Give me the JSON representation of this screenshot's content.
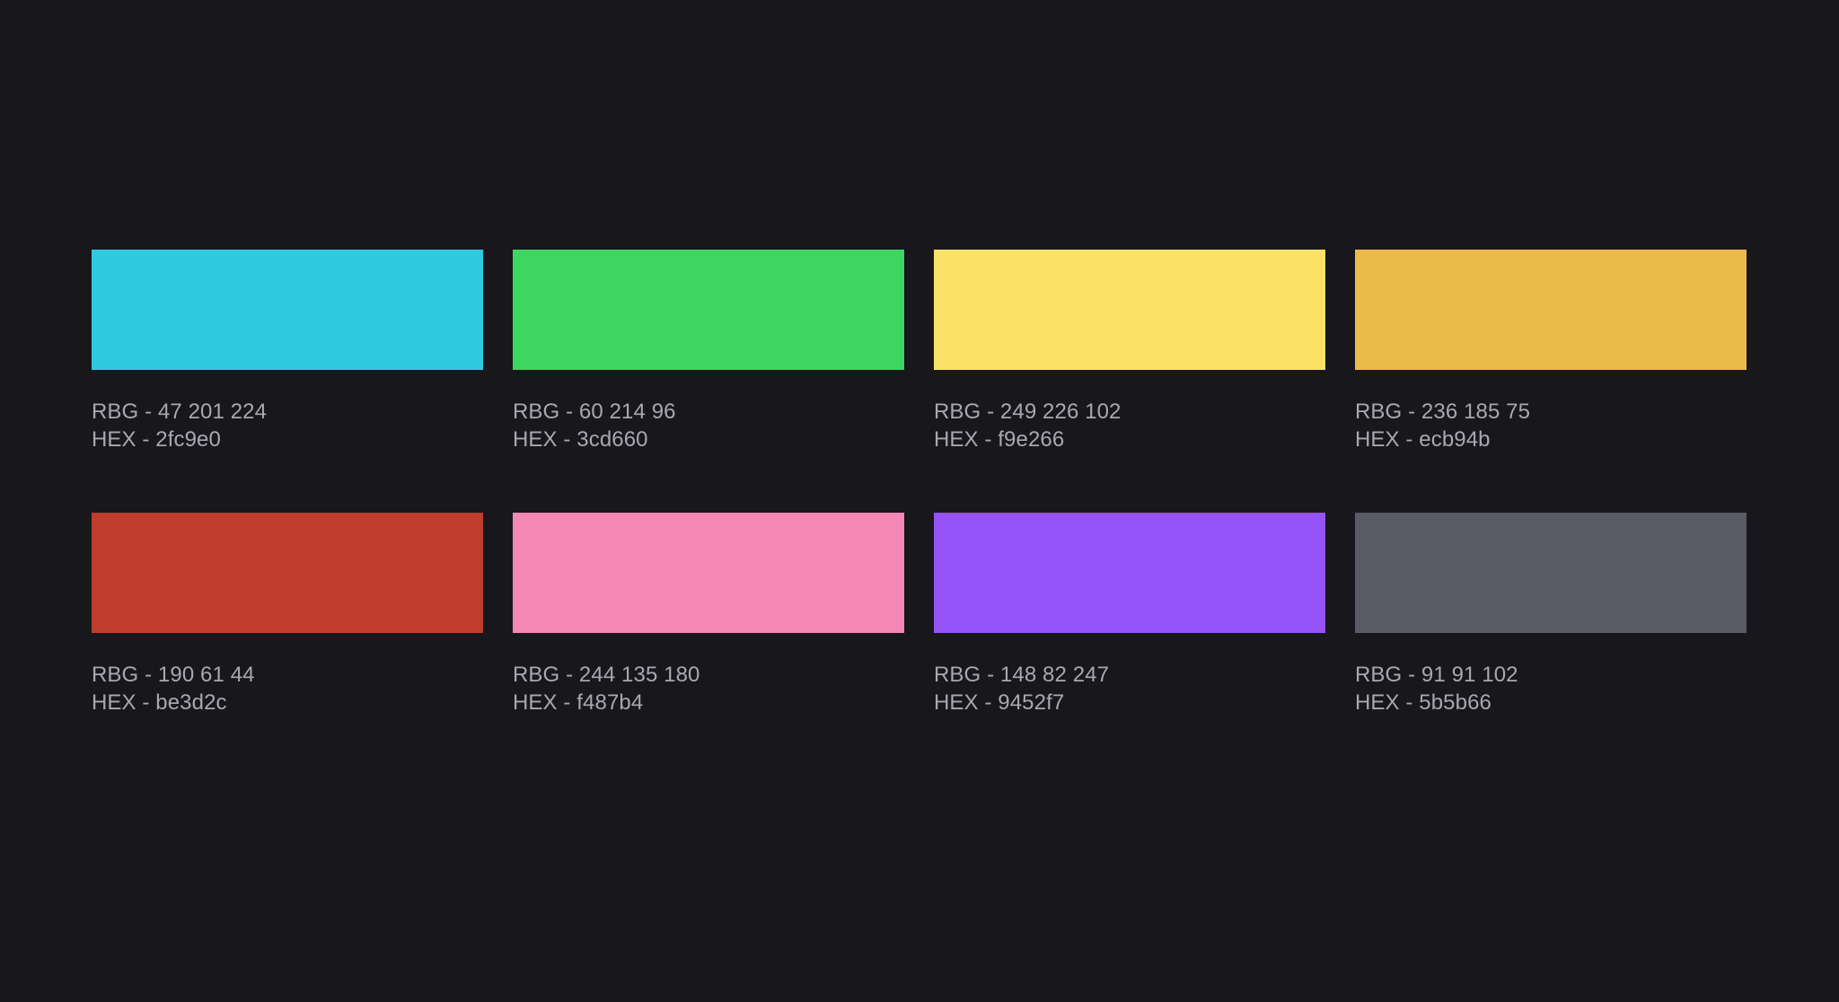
{
  "swatches": [
    {
      "rgb_label": "RBG - 47 201 224",
      "hex_label": "HEX - 2fc9e0",
      "color": "#2fc9e0"
    },
    {
      "rgb_label": "RBG - 60 214 96",
      "hex_label": "HEX - 3cd660",
      "color": "#3cd660"
    },
    {
      "rgb_label": "RBG - 249 226 102",
      "hex_label": "HEX - f9e266",
      "color": "#f9e266"
    },
    {
      "rgb_label": "RBG - 236 185 75",
      "hex_label": "HEX - ecb94b",
      "color": "#ecb94b"
    },
    {
      "rgb_label": "RBG - 190 61 44",
      "hex_label": "HEX - be3d2c",
      "color": "#be3d2c"
    },
    {
      "rgb_label": "RBG - 244 135 180",
      "hex_label": "HEX - f487b4",
      "color": "#f487b4"
    },
    {
      "rgb_label": "RBG - 148 82 247",
      "hex_label": "HEX - 9452f7",
      "color": "#9452f7"
    },
    {
      "rgb_label": "RBG - 91 91 102",
      "hex_label": "HEX - 5b5b66",
      "color": "#5b5b66"
    }
  ],
  "theme": {
    "background": "#17171c",
    "text": "#a8a8b0"
  }
}
